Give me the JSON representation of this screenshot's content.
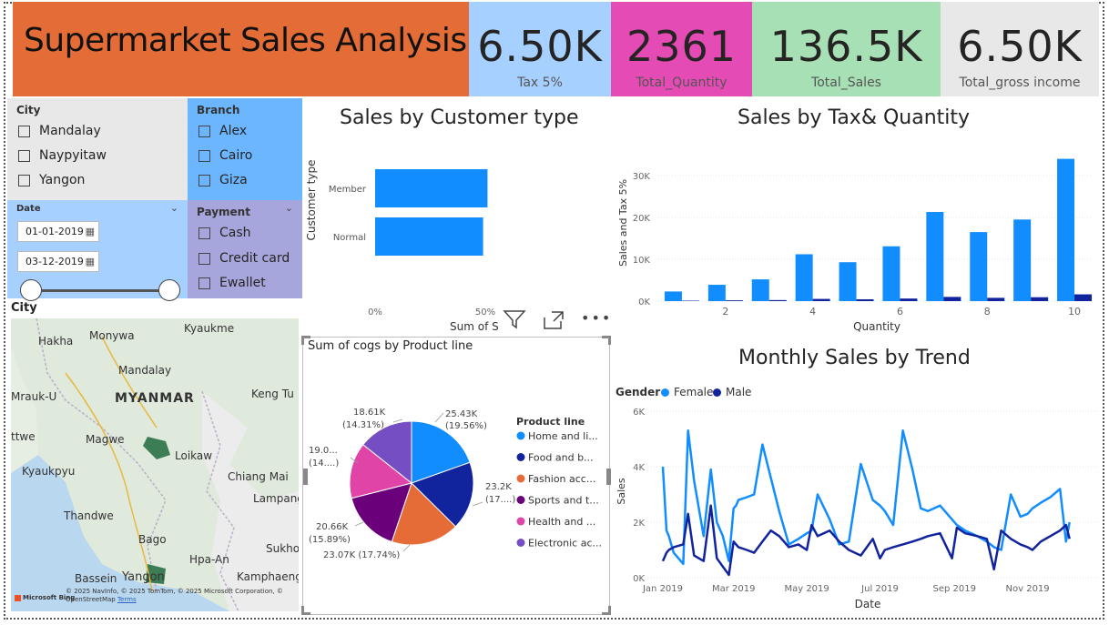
{
  "header": {
    "title": "Supermarket Sales Analysis",
    "cards": [
      {
        "value": "6.50K",
        "label": "Tax 5%",
        "color": "#a6d0ff"
      },
      {
        "value": "2361",
        "label": "Total_Quantity",
        "color": "#e44bb5"
      },
      {
        "value": "136.5K",
        "label": "Total_Sales",
        "color": "#a8e0b6"
      },
      {
        "value": "6.50K",
        "label": "Total_gross income",
        "color": "#e8e8e8"
      }
    ]
  },
  "slicers": {
    "city": {
      "title": "City",
      "options": [
        "Mandalay",
        "Naypyitaw",
        "Yangon"
      ]
    },
    "branch": {
      "title": "Branch",
      "options": [
        "Alex",
        "Cairo",
        "Giza"
      ]
    },
    "date": {
      "title": "Date",
      "start": "01-01-2019",
      "end": "03-12-2019"
    },
    "payment": {
      "title": "Payment",
      "options": [
        "Cash",
        "Credit card",
        "Ewallet"
      ]
    }
  },
  "map": {
    "title": "City",
    "labels": [
      "Hakha",
      "Monywa",
      "Kyaukme",
      "Mandalay",
      "Mrauk-U",
      "MYANMAR",
      "Keng Tu",
      "ttwe",
      "Magwe",
      "Loikaw",
      "Kyaukpyu",
      "Chiang Mai",
      "Lampang",
      "Thandwe",
      "Bago",
      "Hpa-An",
      "Sukho",
      "Bassein",
      "Yangon",
      "Kamphaeng"
    ],
    "attribution": "© 2025 NavInfo, © 2025 TomTom, © 2025 Microsoft Corporation, © OpenStreetMap",
    "attribution_links": "Terms",
    "bing": "Microsoft Bing"
  },
  "customer_chart": {
    "title": "Sales by Customer type",
    "ylabel": "Customer type",
    "xlabel": "Sum of S",
    "xticks": [
      "0%",
      "50%"
    ],
    "icons": [
      "filter-icon",
      "focus-mode-icon",
      "more-options-icon"
    ]
  },
  "pie_chart": {
    "title": "Sum of cogs by Product line",
    "legend_title": "Product line",
    "legend": [
      "Home and li...",
      "Food and b...",
      "Fashion acc...",
      "Sports and t...",
      "Health and ...",
      "Electronic ac..."
    ],
    "slice_labels": [
      {
        "value": "25.43K",
        "pct": "(19.56%)"
      },
      {
        "value": "23.2K",
        "pct": "(17....)"
      },
      {
        "value": "23.07K (17.74%)",
        "pct": ""
      },
      {
        "value": "20.66K",
        "pct": "(15.89%)"
      },
      {
        "value": "19.0...",
        "pct": "(14....)"
      },
      {
        "value": "18.61K",
        "pct": "(14.31%)"
      }
    ]
  },
  "tax_chart": {
    "title": "Sales by Tax& Quantity",
    "ylabel": "Sales and Tax 5%",
    "xlabel": "Quantity",
    "yticks": [
      "0K",
      "10K",
      "20K",
      "30K"
    ],
    "xticks": [
      "2",
      "4",
      "6",
      "8",
      "10"
    ]
  },
  "trend_chart": {
    "title": "Monthly Sales by Trend",
    "legend_title": "Gender",
    "legend": [
      "Female",
      "Male"
    ],
    "ylabel": "Sales",
    "xlabel": "Date",
    "yticks": [
      "0K",
      "2K",
      "4K",
      "6K"
    ],
    "xticks": [
      "Jan 2019",
      "Mar 2019",
      "May 2019",
      "Jul 2019",
      "Sep 2019",
      "Nov 2019"
    ]
  },
  "colors": {
    "primary": "#118dff",
    "dark": "#12239e",
    "orange": "#e66c37",
    "purple": "#6b007b",
    "pink": "#e044a7",
    "violet": "#744ec2"
  },
  "chart_data": [
    {
      "type": "bar",
      "title": "Sales by Customer type",
      "categories": [
        "Member",
        "Normal"
      ],
      "values": [
        0.51,
        0.49
      ],
      "xlabel": "Sum of S",
      "ylabel": "Customer type"
    },
    {
      "type": "pie",
      "title": "Sum of cogs by Product line",
      "categories": [
        "Home and li...",
        "Food and b...",
        "Fashion acc...",
        "Sports and t...",
        "Health and ...",
        "Electronic ac..."
      ],
      "values": [
        25.43,
        23.2,
        23.07,
        20.66,
        19.0,
        18.61
      ]
    },
    {
      "type": "bar",
      "title": "Sales by Tax& Quantity",
      "x": [
        1,
        2,
        3,
        4,
        5,
        6,
        7,
        8,
        9,
        10
      ],
      "series": [
        {
          "values": [
            2300,
            3900,
            5200,
            11200,
            9300,
            13100,
            21300,
            16500,
            19500,
            34000
          ]
        },
        {
          "values": [
            110,
            190,
            250,
            530,
            440,
            620,
            1010,
            790,
            930,
            1620
          ]
        }
      ],
      "ylim": [
        0,
        35000
      ],
      "xlabel": "Quantity",
      "ylabel": "Sales and Tax 5%"
    },
    {
      "type": "line",
      "title": "Monthly Sales by Trend",
      "x": [
        "2019-01-01",
        "2019-01-04",
        "2019-01-06",
        "2019-01-10",
        "2019-01-18",
        "2019-01-22",
        "2019-01-27",
        "2019-02-04",
        "2019-02-10",
        "2019-02-15",
        "2019-02-20",
        "2019-02-25",
        "2019-03-01",
        "2019-03-03",
        "2019-03-05",
        "2019-03-12",
        "2019-03-18",
        "2019-03-25",
        "2019-04-01",
        "2019-04-08",
        "2019-04-16",
        "2019-04-24",
        "2019-05-01",
        "2019-05-05",
        "2019-05-10",
        "2019-05-20",
        "2019-05-28",
        "2019-06-05",
        "2019-06-15",
        "2019-06-25",
        "2019-07-01",
        "2019-07-05",
        "2019-07-12",
        "2019-07-20",
        "2019-07-28",
        "2019-08-04",
        "2019-08-10",
        "2019-08-20",
        "2019-08-30",
        "2019-09-03",
        "2019-09-10",
        "2019-09-20",
        "2019-09-28",
        "2019-10-04",
        "2019-10-10",
        "2019-10-18",
        "2019-10-26",
        "2019-11-01",
        "2019-11-05",
        "2019-11-12",
        "2019-11-20",
        "2019-11-28",
        "2019-12-03",
        "2019-12-06"
      ],
      "series": [
        {
          "name": "Female",
          "values": [
            4000,
            1700,
            1500,
            900,
            500,
            5300,
            3500,
            1500,
            3900,
            2000,
            1500,
            600,
            2500,
            2600,
            2800,
            2900,
            3000,
            4800,
            3600,
            2400,
            1200,
            1400,
            1600,
            1700,
            3000,
            2100,
            1200,
            1300,
            4100,
            2800,
            2600,
            2400,
            1900,
            5300,
            3900,
            2500,
            2400,
            2600,
            2100,
            1900,
            1700,
            1500,
            1300,
            1100,
            1000,
            3000,
            2200,
            2300,
            2500,
            2700,
            2900,
            3200,
            1300,
            2000
          ]
        },
        {
          "name": "Male",
          "values": [
            600,
            900,
            1000,
            1100,
            1200,
            2300,
            800,
            600,
            2600,
            700,
            400,
            100,
            1300,
            1200,
            1100,
            1000,
            900,
            1300,
            1700,
            1500,
            1100,
            1200,
            1000,
            1900,
            1500,
            1700,
            1300,
            1000,
            800,
            1400,
            700,
            1000,
            1100,
            1200,
            1300,
            1400,
            1500,
            1600,
            700,
            1800,
            1600,
            1500,
            1400,
            300,
            1700,
            1400,
            1200,
            1100,
            1000,
            1300,
            1500,
            1700,
            1900,
            1400
          ]
        }
      ],
      "ylim": [
        0,
        6000
      ],
      "xlabel": "Date",
      "ylabel": "Sales"
    }
  ]
}
